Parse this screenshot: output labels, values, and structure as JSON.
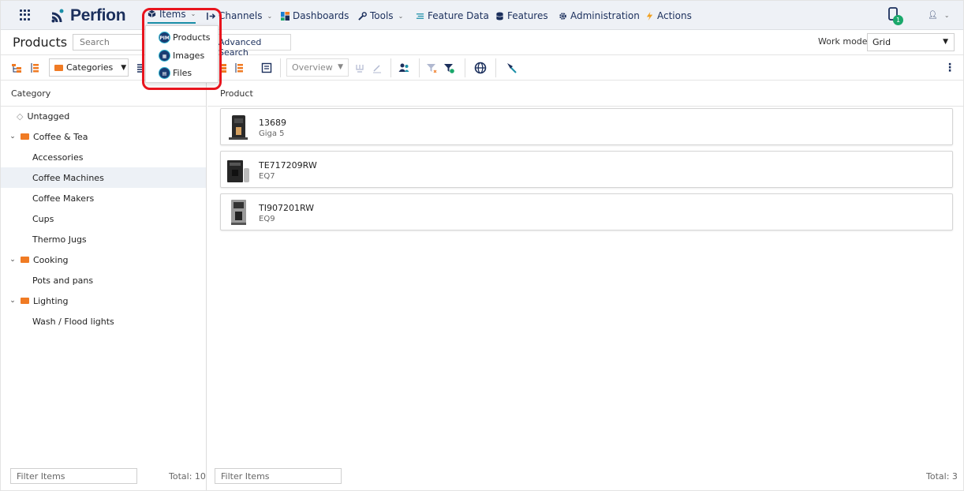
{
  "app": {
    "logo_text": "Perfion"
  },
  "nav": {
    "items_label": "Items",
    "channels_label": "Channels",
    "dashboards_label": "Dashboards",
    "tools_label": "Tools",
    "feature_data_label": "Feature Data",
    "features_label": "Features",
    "administration_label": "Administration",
    "actions_label": "Actions",
    "notification_count": "1"
  },
  "items_menu": [
    {
      "label": "Products",
      "icon": "pim-icon",
      "icon_text": "PIM"
    },
    {
      "label": "Images",
      "icon": "images-icon"
    },
    {
      "label": "Files",
      "icon": "files-icon"
    }
  ],
  "titlebar": {
    "title": "Products",
    "search_placeholder": "Search",
    "advanced_search_label": "Advanced Search",
    "work_mode_label": "Work mode",
    "work_mode_value": "Grid"
  },
  "toolbar": {
    "categories_label": "Categories",
    "overview_label": "Overview"
  },
  "left": {
    "header": "Category",
    "tree": [
      {
        "label": "Untagged",
        "type": "untagged"
      },
      {
        "label": "Coffee & Tea",
        "type": "folder"
      },
      {
        "label": "Accessories",
        "type": "leaf"
      },
      {
        "label": "Coffee Machines",
        "type": "leaf",
        "selected": true
      },
      {
        "label": "Coffee Makers",
        "type": "leaf"
      },
      {
        "label": "Cups",
        "type": "leaf"
      },
      {
        "label": "Thermo Jugs",
        "type": "leaf"
      },
      {
        "label": "Cooking",
        "type": "folder"
      },
      {
        "label": "Pots and pans",
        "type": "leaf"
      },
      {
        "label": "Lighting",
        "type": "folder"
      },
      {
        "label": "Wash / Flood lights",
        "type": "leaf"
      }
    ],
    "filter_placeholder": "Filter Items",
    "total": "Total: 10"
  },
  "right": {
    "header": "Product",
    "products": [
      {
        "id": "13689",
        "name": "Giga 5"
      },
      {
        "id": "TE717209RW",
        "name": "EQ7"
      },
      {
        "id": "TI907201RW",
        "name": "EQ9"
      }
    ],
    "filter_placeholder": "Filter Items",
    "total": "Total: 3"
  },
  "colors": {
    "brand": "#1b2f5c",
    "accent": "#1b8fa8",
    "folder": "#f07b24",
    "highlight": "#e8151e",
    "badge": "#1aa86b"
  }
}
